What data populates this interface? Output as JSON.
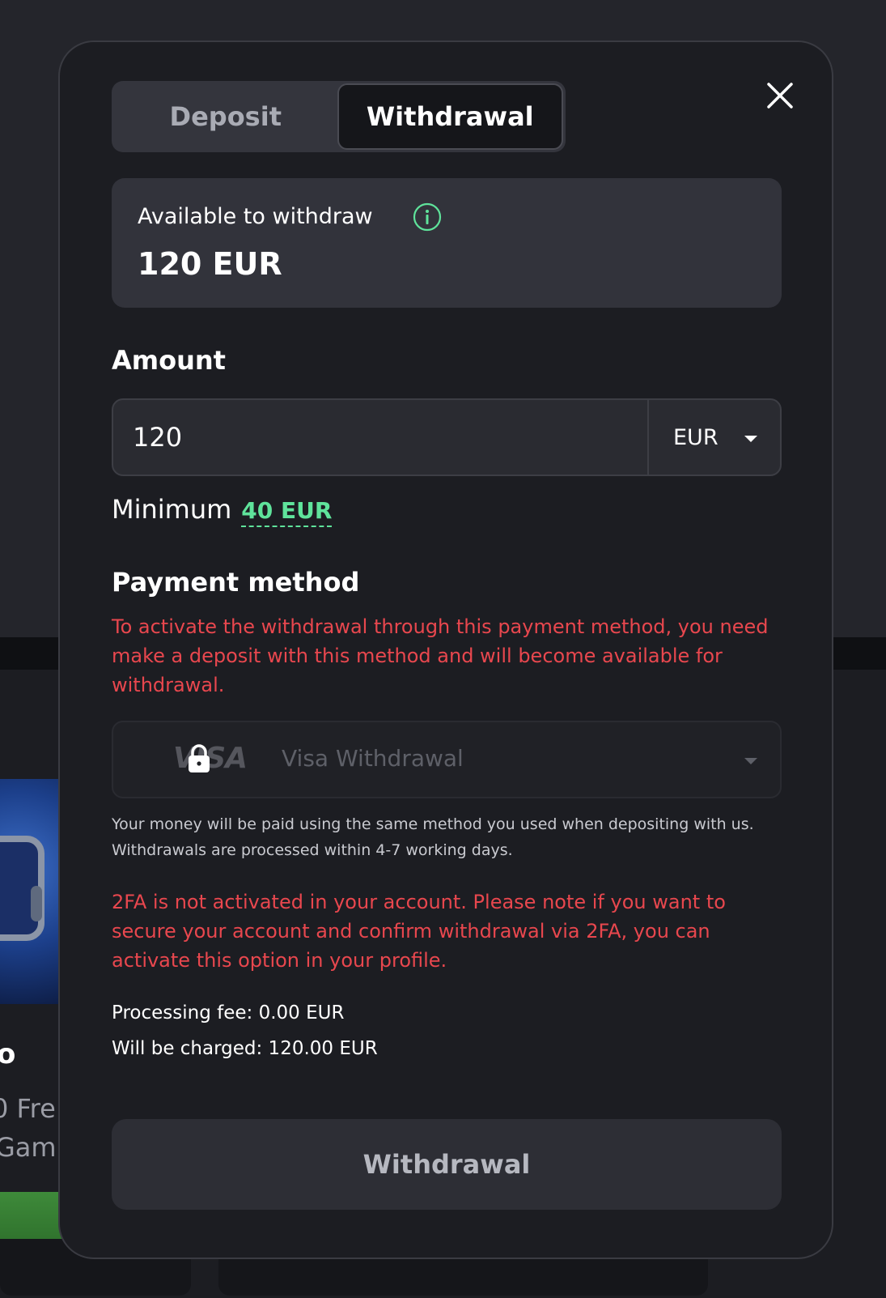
{
  "background": {
    "card_title_fragment": "o",
    "card_line1_fragment": "0 Fre",
    "card_line2_fragment": "Gam"
  },
  "tabs": [
    {
      "label": "Deposit",
      "active": false
    },
    {
      "label": "Withdrawal",
      "active": true
    }
  ],
  "balance": {
    "label": "Available to withdraw",
    "amount": "120 EUR",
    "info_icon": "info-circle-icon"
  },
  "amount": {
    "label": "Amount",
    "value": "120",
    "currency": "EUR",
    "minimum_label": "Minimum",
    "minimum_value": "40 EUR"
  },
  "payment_method": {
    "label": "Payment method",
    "warning": "To activate the withdrawal through this payment method, you need make a deposit with this method and will become available for withdrawal.",
    "logo_text": "VISA",
    "selected": "Visa Withdrawal",
    "note": "Your money will be paid using the same method you used when depositing with us. Withdrawals are processed within 4-7 working days."
  },
  "twofa_warning": "2FA is not activated in your account. Please note if you want to secure your account and confirm withdrawal via 2FA, you can activate this option in your profile.",
  "fees": {
    "processing": "Processing fee: 0.00 EUR",
    "charged": "Will be charged: 120.00 EUR"
  },
  "submit_label": "Withdrawal",
  "colors": {
    "accent_green": "#5fe39b",
    "warning_red": "#e8474e",
    "modal_bg": "#1c1d22"
  }
}
